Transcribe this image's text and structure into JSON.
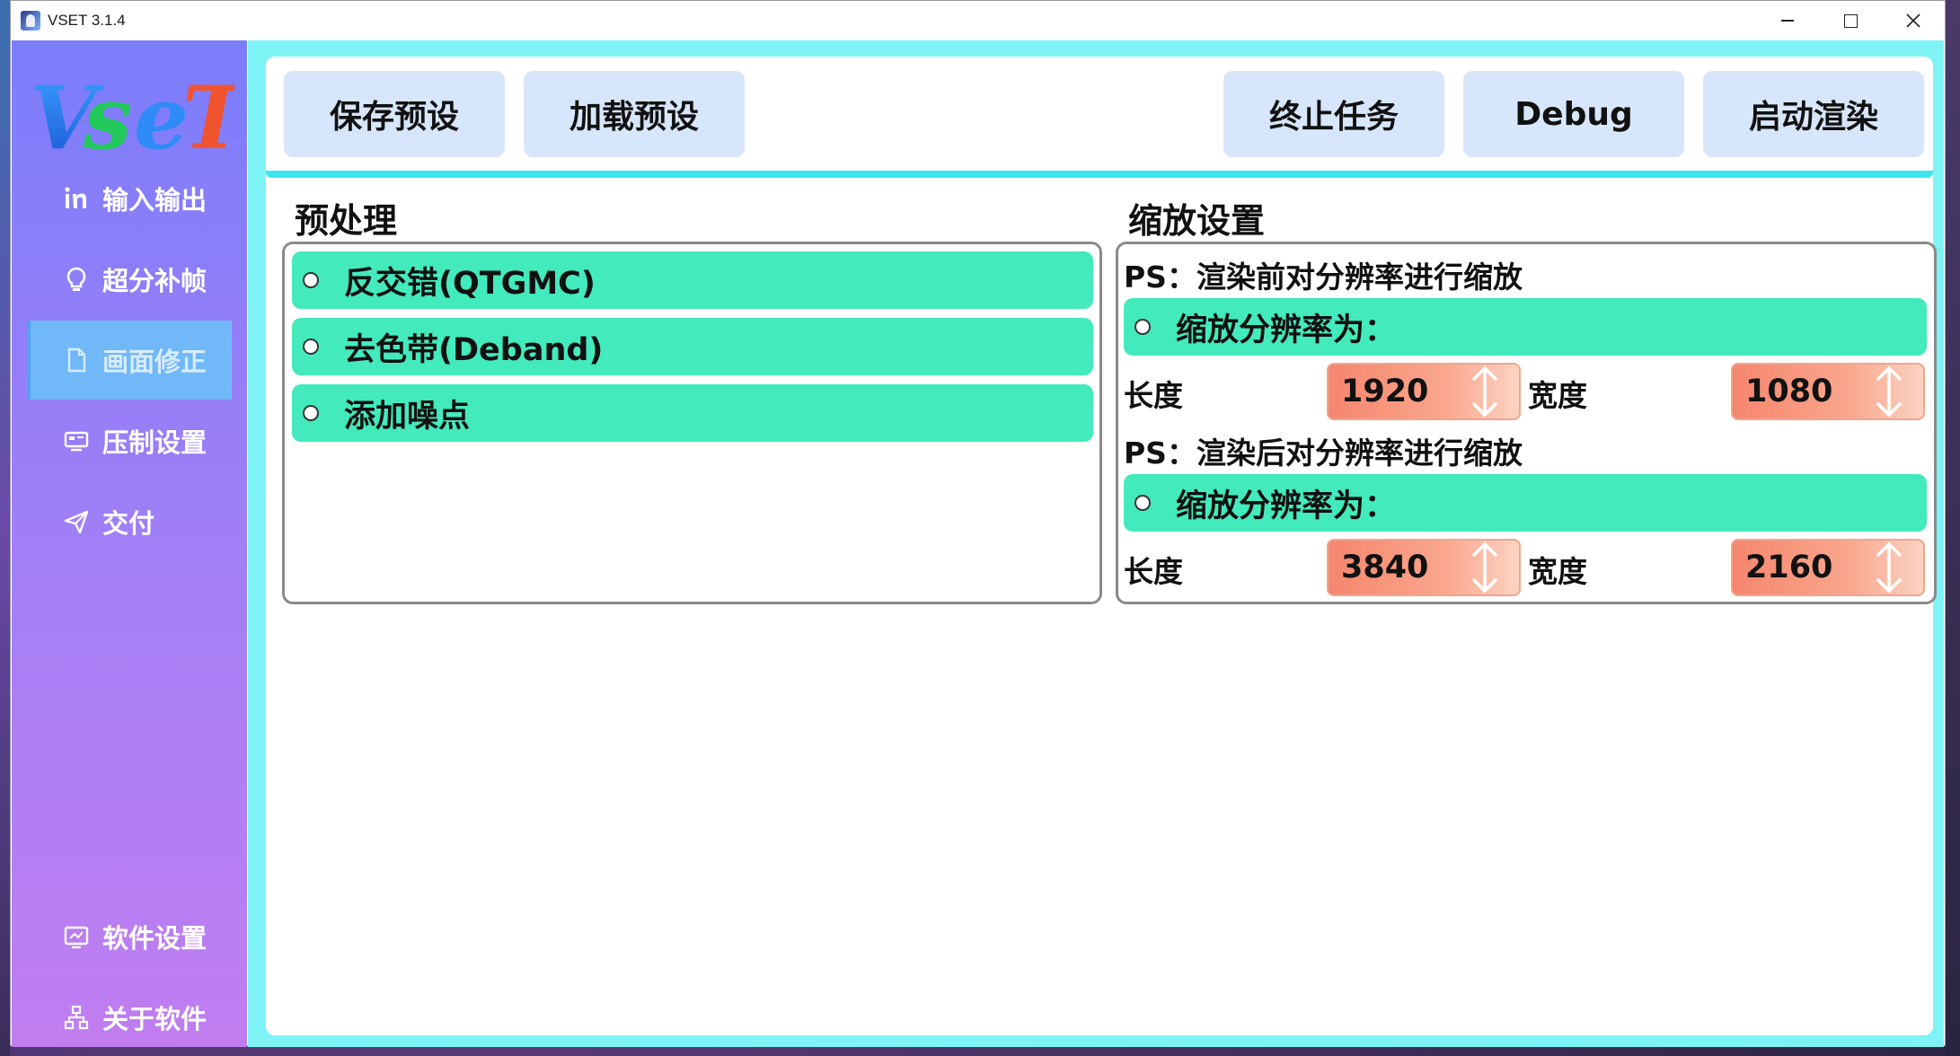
{
  "window": {
    "title": "VSET 3.1.4"
  },
  "brand": {
    "logo_text": "VSET",
    "colors": [
      "#2f8bf5",
      "#21c85a",
      "#f0e32c",
      "#2f8bf5",
      "#f0542f"
    ]
  },
  "sidebar": {
    "items": [
      {
        "label": "输入输出",
        "icon": "linkedin-icon"
      },
      {
        "label": "超分补帧",
        "icon": "bulb-icon"
      },
      {
        "label": "画面修正",
        "icon": "document-icon",
        "active": true
      },
      {
        "label": "压制设置",
        "icon": "device-icon"
      },
      {
        "label": "交付",
        "icon": "send-icon"
      }
    ],
    "bottom_items": [
      {
        "label": "软件设置",
        "icon": "monitor-chart-icon"
      },
      {
        "label": "关于软件",
        "icon": "sitemap-icon"
      }
    ]
  },
  "toolbar": {
    "save_preset": "保存预设",
    "load_preset": "加载预设",
    "stop_task": "终止任务",
    "debug": "Debug",
    "start_render": "启动渲染"
  },
  "preprocess": {
    "title": "预处理",
    "options": [
      "反交错(QTGMC)",
      "去色带(Deband)",
      "添加噪点"
    ]
  },
  "scale": {
    "title": "缩放设置",
    "before": {
      "note": "PS：渲染前对分辨率进行缩放",
      "option": "缩放分辨率为：",
      "length_label": "长度",
      "length_value": "1920",
      "width_label": "宽度",
      "width_value": "1080"
    },
    "after": {
      "note": "PS：渲染后对分辨率进行缩放",
      "option": "缩放分辨率为：",
      "length_label": "长度",
      "length_value": "3840",
      "width_label": "宽度",
      "width_value": "2160"
    }
  },
  "colors": {
    "accent_cyan": "#3de6ef",
    "option_green": "#43eabc",
    "spin_orange": "#f5866e",
    "sidebar_top": "#7b7dfb",
    "sidebar_bottom": "#c07df0",
    "active_item": "#70b8f8"
  }
}
